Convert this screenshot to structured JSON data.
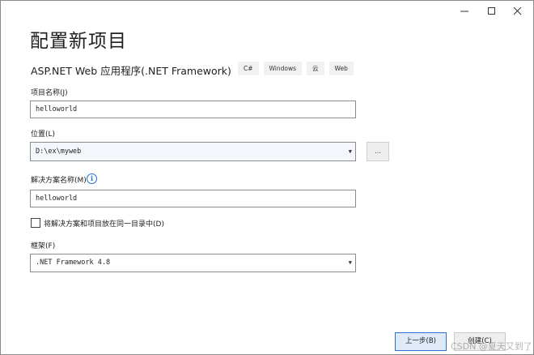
{
  "window_controls": {
    "minimize": "—",
    "maximize": "□",
    "close": "✕"
  },
  "title": "配置新项目",
  "subtitle": "ASP.NET Web 应用程序(.NET Framework)",
  "tags": [
    "C#",
    "Windows",
    "云",
    "Web"
  ],
  "project_name": {
    "label": "项目名称(J)",
    "value": "helloworld"
  },
  "location": {
    "label": "位置(L)",
    "value": "D:\\ex\\myweb",
    "browse_label": "..."
  },
  "solution_name": {
    "label": "解决方案名称(M)",
    "value": "helloworld",
    "info_icon": "i"
  },
  "same_dir_checkbox": {
    "label": "将解决方案和项目放在同一目录中(D)",
    "checked": false
  },
  "framework": {
    "label": "框架(F)",
    "value": ".NET Framework 4.8"
  },
  "buttons": {
    "back": "上一步(B)",
    "create": "创建(C)"
  },
  "watermark": "CSDN @夏天又到了"
}
